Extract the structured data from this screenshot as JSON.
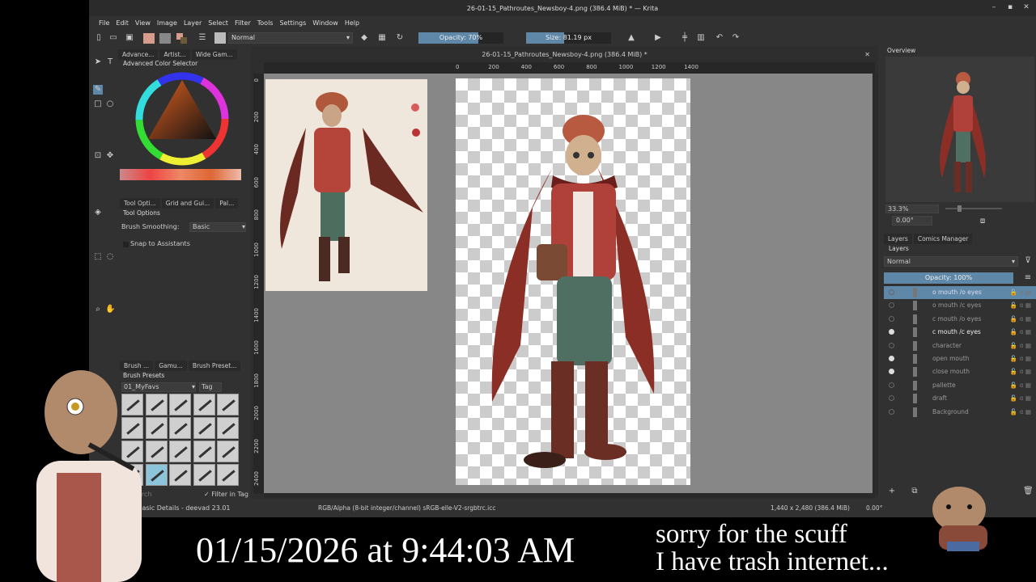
{
  "window": {
    "title": "26-01-15_Pathroutes_Newsboy-4.png (386.4 MiB) * — Krita"
  },
  "menu": [
    "File",
    "Edit",
    "View",
    "Image",
    "Layer",
    "Select",
    "Filter",
    "Tools",
    "Settings",
    "Window",
    "Help"
  ],
  "toolbar": {
    "blend_mode": "Normal",
    "opacity": "Opacity: 70%",
    "opacity_value": 70,
    "size": "Size: 81.19 px"
  },
  "left_dock": {
    "top_tabs": [
      "Advance...",
      "Artist...",
      "Wide Gam..."
    ],
    "color_selector_title": "Advanced Color Selector",
    "mid_tabs": [
      "Tool Opti...",
      "Grid and Gui...",
      "Pal..."
    ],
    "tool_options_title": "Tool Options",
    "brush_smoothing_label": "Brush Smoothing:",
    "brush_smoothing_value": "Basic",
    "snap_label": "Snap to Assistants",
    "bottom_tabs": [
      "Brush ...",
      "Gamu...",
      "Brush Preset..."
    ],
    "brush_presets_title": "Brush Presets",
    "preset_tag": "01_MyFavs",
    "tag_button": "Tag",
    "search_placeholder": "Search",
    "filter_in_tag": "Filter in Tag",
    "current_preset": "Basic Details - deevad 23.01"
  },
  "canvas": {
    "tab_title": "26-01-15_Pathroutes_Newsboy-4.png (386.4 MiB) *",
    "h_ruler": [
      "0",
      "200",
      "400",
      "600",
      "800",
      "1000",
      "1200",
      "1400"
    ],
    "v_ruler": [
      "0",
      "200",
      "400",
      "600",
      "800",
      "1000",
      "1200",
      "1400",
      "1600",
      "1800",
      "2000",
      "2200",
      "2400"
    ]
  },
  "right_dock": {
    "overview_title": "Overview",
    "zoom": "33.3%",
    "rotation": "0.00°",
    "tabs": [
      "Layers",
      "Comics Manager"
    ],
    "layers_title": "Layers",
    "blend_mode": "Normal",
    "opacity": "Opacity:  100%",
    "layers": [
      {
        "name": "o mouth /o eyes",
        "visible": false,
        "selected": true
      },
      {
        "name": "o mouth /c eyes",
        "visible": false
      },
      {
        "name": "c mouth /o eyes",
        "visible": false
      },
      {
        "name": "c mouth /c eyes",
        "visible": true
      },
      {
        "name": "character",
        "visible": false
      },
      {
        "name": "open mouth",
        "visible": true
      },
      {
        "name": "close mouth",
        "visible": true
      },
      {
        "name": "pallette",
        "visible": false
      },
      {
        "name": "draft",
        "visible": false
      },
      {
        "name": "Background",
        "visible": false
      }
    ]
  },
  "statusbar": {
    "color_space": "RGB/Alpha (8-bit integer/channel)  sRGB-elle-V2-srgbtrc.icc",
    "dimensions": "1,440 x 2,480 (386.4 MiB)",
    "rotation": "0.00°"
  },
  "overlay": {
    "clock": "01/15/2026 at 9:44:03 AM",
    "caption_line1": "sorry for the scuff",
    "caption_line2": "I have trash internet..."
  }
}
